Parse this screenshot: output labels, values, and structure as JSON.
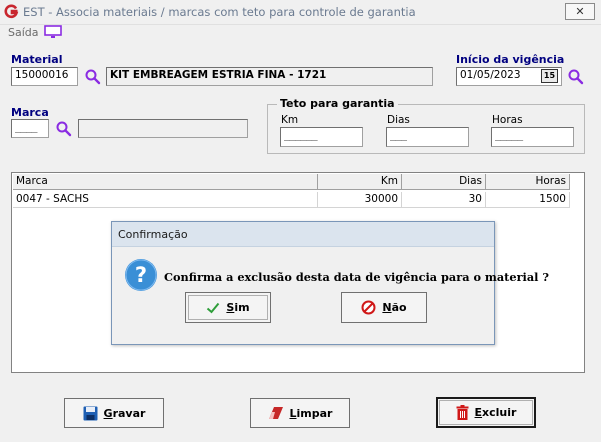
{
  "window": {
    "title": "EST - Associa materiais / marcas com teto para controle de garantia",
    "close_glyph": "✕"
  },
  "menu": {
    "saida": "Saída"
  },
  "material": {
    "label": "Material",
    "code": "15000016",
    "description": "KIT EMBREAGEM ESTRIA FINA - 1721"
  },
  "vigencia": {
    "label": "Início da vigência",
    "date": "01/05/2023",
    "calendar_badge": "15"
  },
  "marca": {
    "label": "Marca",
    "code_mask": "____",
    "description": ""
  },
  "teto": {
    "title": "Teto para garantia",
    "km": {
      "label": "Km",
      "mask": "______"
    },
    "dias": {
      "label": "Dias",
      "mask": "___"
    },
    "horas": {
      "label": "Horas",
      "mask": "_____"
    }
  },
  "grid": {
    "headers": {
      "marca": "Marca",
      "km": "Km",
      "dias": "Dias",
      "horas": "Horas"
    },
    "rows": [
      {
        "marca": "0047 - SACHS",
        "km": "30000",
        "dias": "30",
        "horas": "1500"
      }
    ]
  },
  "dialog": {
    "title": "Confirmação",
    "message": "Confirma a exclusão desta data de vigência para o material ?",
    "sim": {
      "mnemonic": "S",
      "rest": "im"
    },
    "nao": {
      "mnemonic": "N",
      "rest": "ão"
    }
  },
  "buttons": {
    "gravar": {
      "mnemonic": "G",
      "rest": "ravar"
    },
    "limpar": {
      "mnemonic": "L",
      "rest": "impar"
    },
    "excluir": {
      "mnemonic": "E",
      "rest": "xcluir"
    }
  },
  "colors": {
    "accent": "#000080",
    "dialog_titlebar": "#dbe4ee",
    "question_blue": "#3a8fd6",
    "no_red": "#d01818",
    "check_green": "#2e9e3a",
    "search_purple": "#8a2be2"
  }
}
